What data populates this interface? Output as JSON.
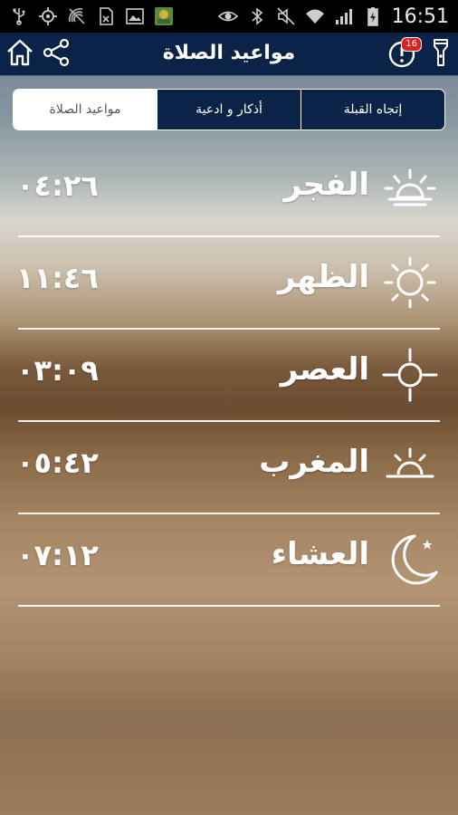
{
  "status_bar": {
    "time": "16:51",
    "left_icons": [
      "usb-icon",
      "gps-icon",
      "no-signal-icon",
      "sim-icon",
      "image-icon",
      "app-icon"
    ],
    "right_icons": [
      "eye-icon",
      "bluetooth-icon",
      "mute-icon",
      "wifi-icon",
      "signal-icon",
      "battery-charging-icon"
    ]
  },
  "app_bar": {
    "title": "مواعيد الصلاة",
    "notification_count": "16",
    "left_icons": [
      "home-icon",
      "share-icon"
    ],
    "right_icons": [
      "alert-icon",
      "flashlight-icon"
    ]
  },
  "tabs": [
    {
      "label": "مواعيد الصلاة",
      "active": true
    },
    {
      "label": "أذكار و ادعية",
      "active": false
    },
    {
      "label": "إتجاه القبلة",
      "active": false
    }
  ],
  "prayers": [
    {
      "name": "الفجر",
      "time": "٠٤:٢٦",
      "icon": "sunrise-icon"
    },
    {
      "name": "الظهر",
      "time": "١١:٤٦",
      "icon": "sun-icon"
    },
    {
      "name": "العصر",
      "time": "٠٣:٠٩",
      "icon": "sun-horizon-icon"
    },
    {
      "name": "المغرب",
      "time": "٠٥:٤٢",
      "icon": "sunset-icon"
    },
    {
      "name": "العشاء",
      "time": "٠٧:١٢",
      "icon": "moon-star-icon"
    }
  ]
}
